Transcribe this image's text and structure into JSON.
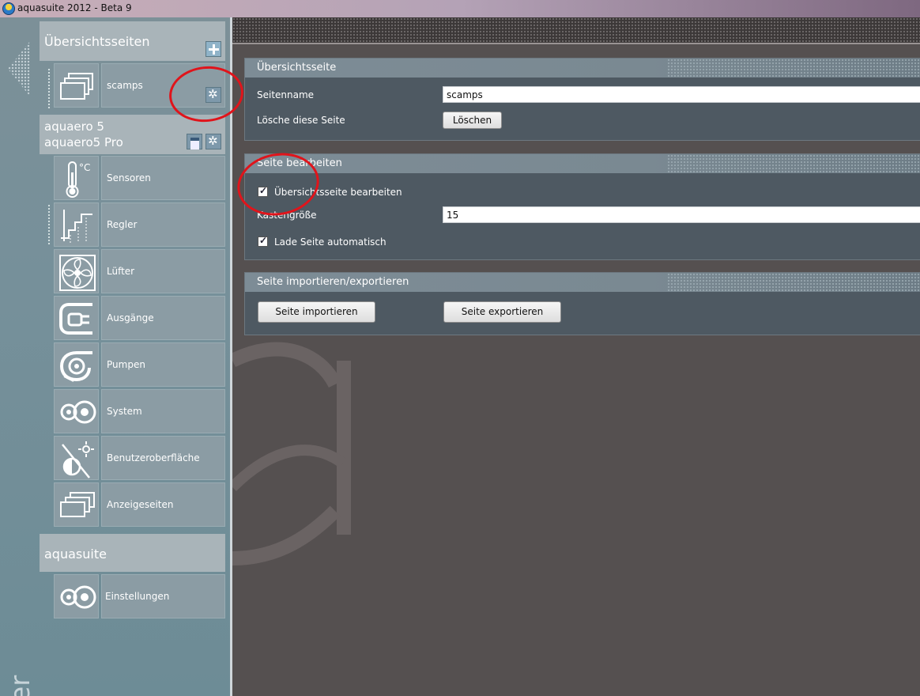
{
  "window": {
    "title": "aquasuite 2012 - Beta 9"
  },
  "sidebar": {
    "overview_header": "Übersichtsseiten",
    "overview_items": [
      {
        "label": "scamps"
      }
    ],
    "device": {
      "name_line1": "aquaero 5",
      "name_line2": "aquaero5 Pro"
    },
    "device_items": [
      {
        "label": "Sensoren",
        "icon": "thermometer-icon"
      },
      {
        "label": "Regler",
        "icon": "controller-icon"
      },
      {
        "label": "Lüfter",
        "icon": "fan-icon"
      },
      {
        "label": "Ausgänge",
        "icon": "plug-icon"
      },
      {
        "label": "Pumpen",
        "icon": "pump-icon"
      },
      {
        "label": "System",
        "icon": "system-gears-icon"
      },
      {
        "label": "Benutzeroberfläche",
        "icon": "display-settings-icon"
      },
      {
        "label": "Anzeigeseiten",
        "icon": "pages-icon"
      }
    ],
    "aquasuite_header": "aquasuite",
    "aquasuite_items": [
      {
        "label": "Einstellungen",
        "icon": "system-gears-icon"
      }
    ],
    "vertical_text": "ter"
  },
  "panels": {
    "overview": {
      "title": "Übersichtsseite",
      "page_name_label": "Seitenname",
      "page_name_value": "scamps",
      "delete_label": "Lösche diese Seite",
      "delete_button": "Löschen"
    },
    "edit": {
      "title": "Seite bearbeiten",
      "edit_overview_label": "Übersichtsseite bearbeiten",
      "edit_overview_checked": true,
      "box_size_label": "Kastengröße",
      "box_size_value": "15",
      "autoload_label": "Lade Seite automatisch",
      "autoload_checked": true
    },
    "import_export": {
      "title": "Seite importieren/exportieren",
      "import_button": "Seite importieren",
      "export_button": "Seite exportieren"
    }
  },
  "colors": {
    "sidebar_bg": "#76909a",
    "panel_bg": "#4e5962",
    "panel_header": "#7d8c96",
    "annotation_red": "#e0141b",
    "main_bg": "#555050"
  }
}
